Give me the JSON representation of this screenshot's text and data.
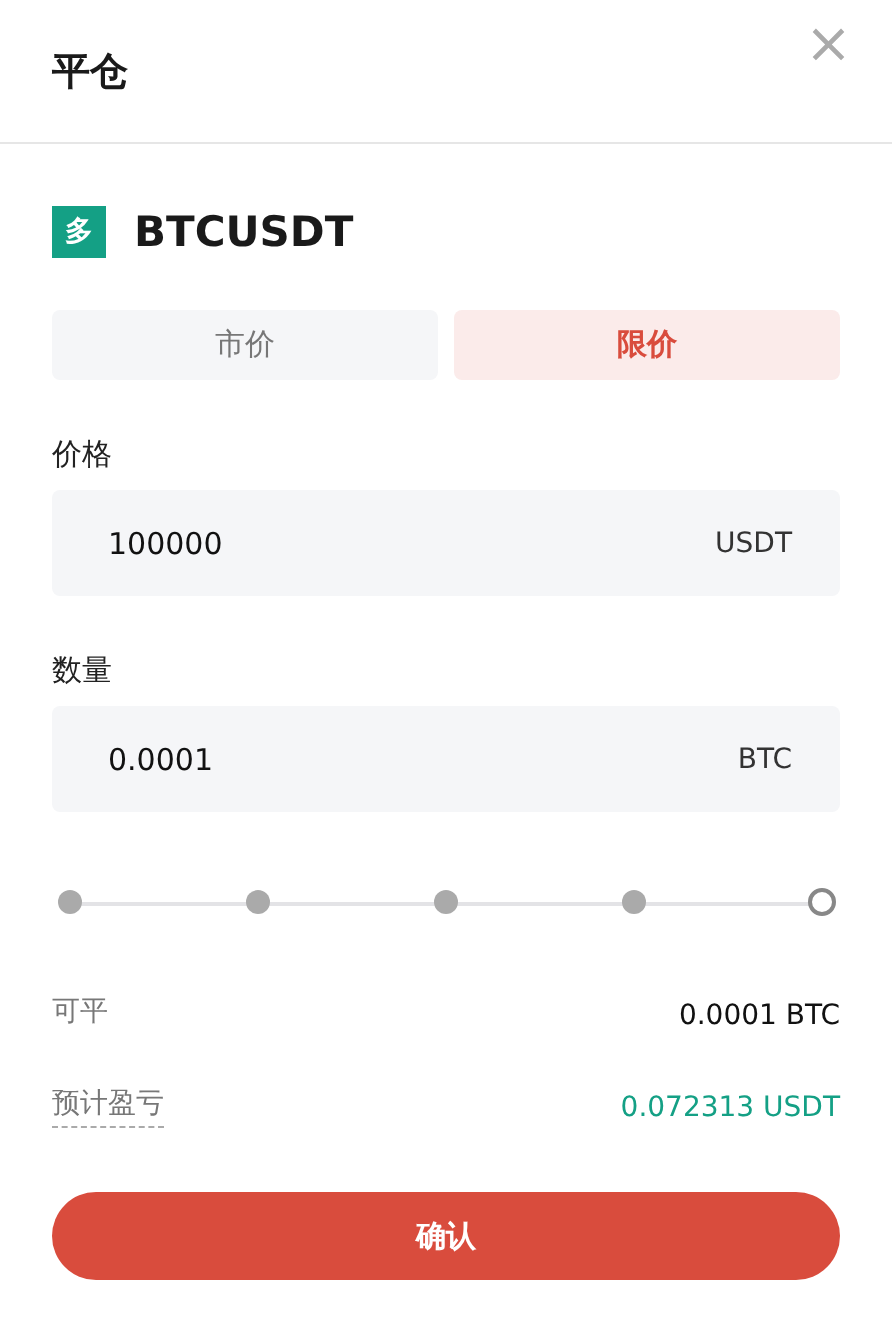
{
  "dialog": {
    "title": "平仓",
    "close_icon": "×"
  },
  "instrument": {
    "side_badge": "多",
    "symbol": "BTCUSDT"
  },
  "order_types": [
    {
      "label": "市价",
      "selected": false
    },
    {
      "label": "限价",
      "selected": true
    }
  ],
  "fields": [
    {
      "label": "价格",
      "value": "100000",
      "unit": "USDT"
    },
    {
      "label": "数量",
      "value": "0.0001",
      "unit": "BTC"
    }
  ],
  "slider": {
    "level": 1
  },
  "summary": [
    {
      "label": "可平",
      "value": "0.0001 BTC",
      "kind": "plain"
    },
    {
      "label": "预计盈亏",
      "value": "0.072313 USDT",
      "kind": "profit"
    }
  ],
  "confirm_button": "确认"
}
